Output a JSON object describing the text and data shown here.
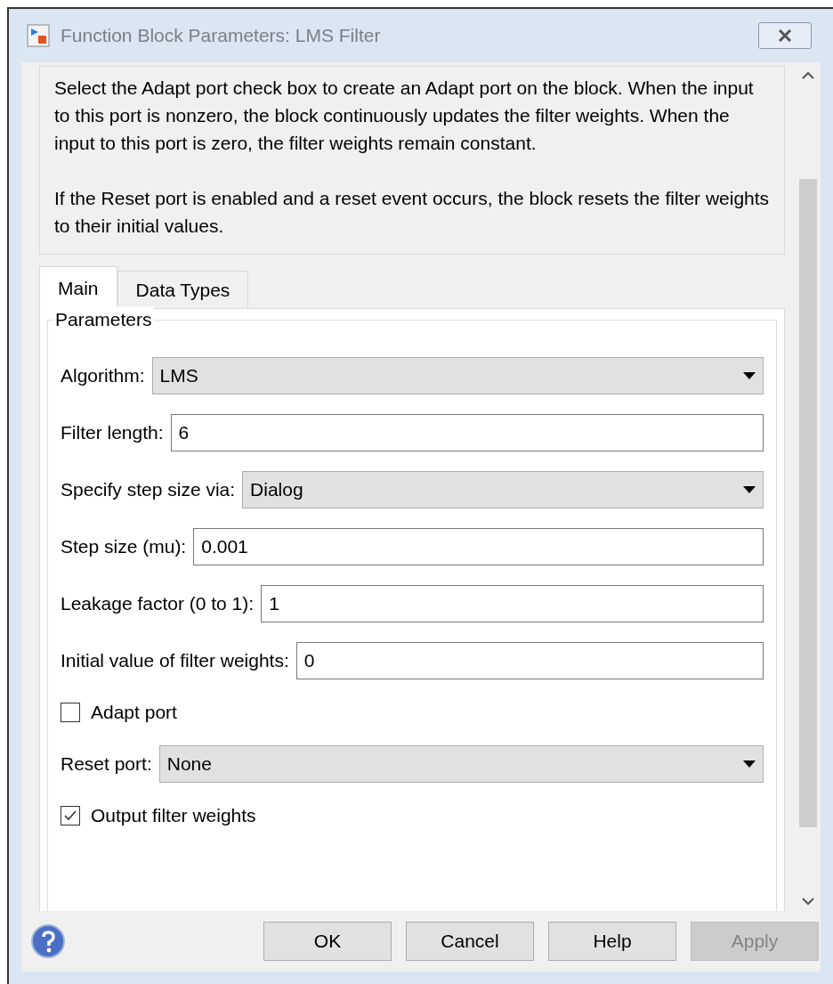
{
  "window": {
    "title": "Function Block Parameters: LMS Filter"
  },
  "description": [
    "Select the Adapt port check box to create an Adapt port on the block. When the input to this port is nonzero, the block continuously updates the filter weights. When the input to this port is zero, the filter weights remain constant.",
    "If the Reset port is enabled and a reset event occurs, the block resets the filter weights to their initial values."
  ],
  "tabs": [
    {
      "label": "Main",
      "selected": true
    },
    {
      "label": "Data Types",
      "selected": false
    }
  ],
  "group": {
    "title": "Parameters"
  },
  "parameters": [
    {
      "kind": "dropdown",
      "label": "Algorithm:",
      "value": "LMS"
    },
    {
      "kind": "text",
      "label": "Filter length:",
      "value": "6"
    },
    {
      "kind": "dropdown",
      "label": "Specify step size via:",
      "value": "Dialog"
    },
    {
      "kind": "text",
      "label": "Step size (mu):",
      "value": "0.001"
    },
    {
      "kind": "text",
      "label": "Leakage factor (0 to 1):",
      "value": "1"
    },
    {
      "kind": "text",
      "label": "Initial value of filter weights:",
      "value": "0"
    },
    {
      "kind": "checkbox",
      "label": "Adapt port",
      "checked": false
    },
    {
      "kind": "dropdown",
      "label": "Reset port:",
      "value": "None"
    },
    {
      "kind": "checkbox",
      "label": "Output filter weights",
      "checked": true
    }
  ],
  "buttons": [
    {
      "label": "OK",
      "disabled": false
    },
    {
      "label": "Cancel",
      "disabled": false
    },
    {
      "label": "Help",
      "disabled": false
    },
    {
      "label": "Apply",
      "disabled": true
    }
  ]
}
